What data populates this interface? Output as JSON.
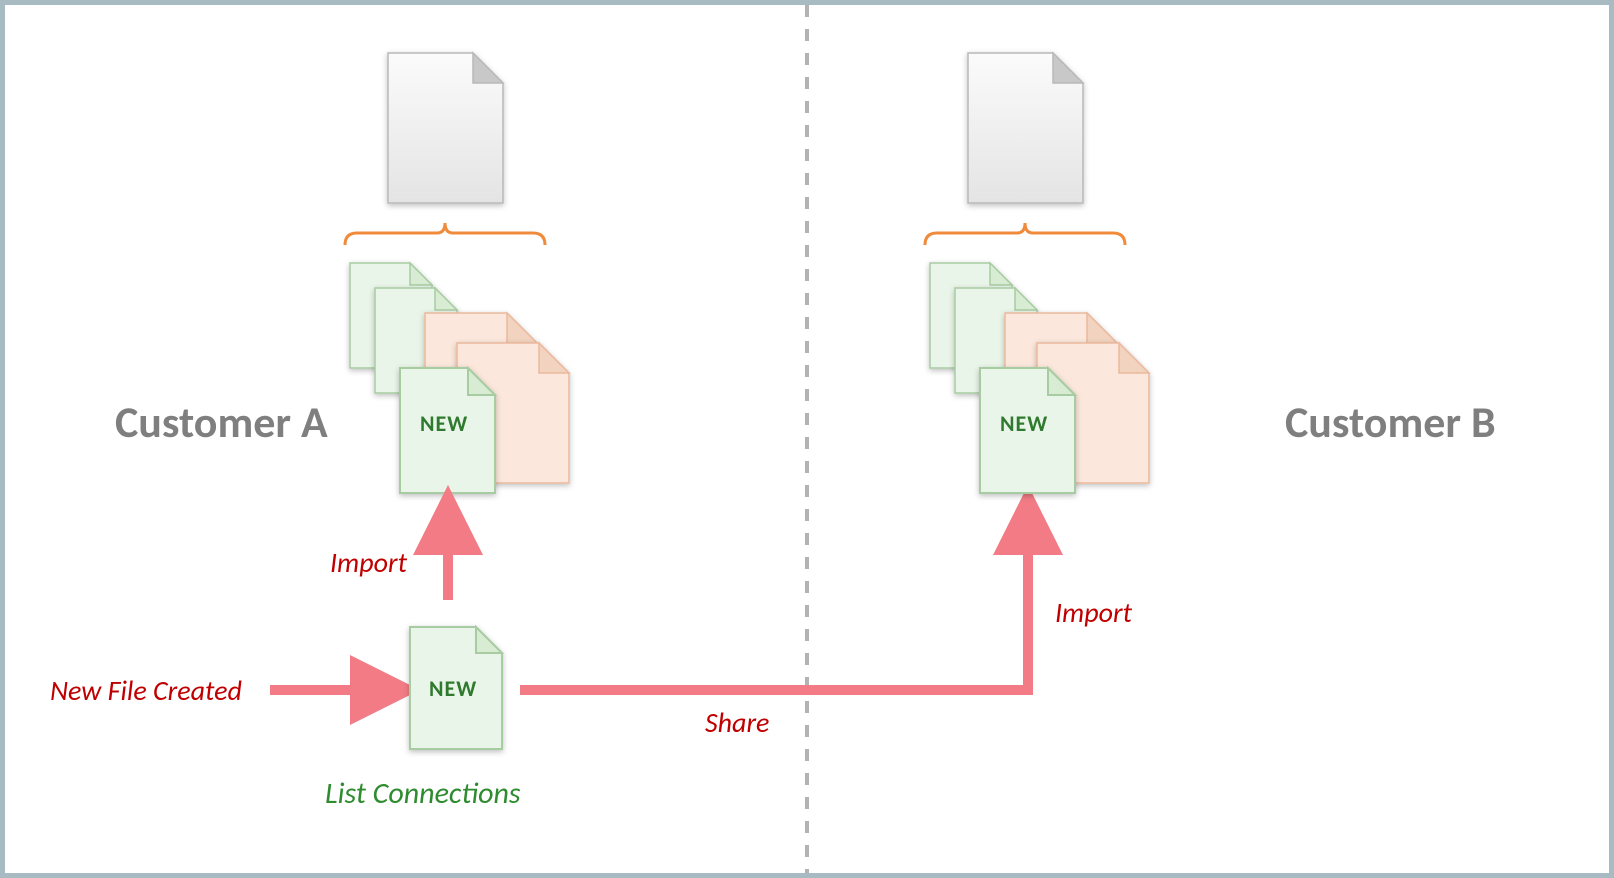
{
  "labels": {
    "customer_a": "Customer A",
    "customer_b": "Customer B",
    "new_file_created": "New File Created",
    "list_connections": "List Connections",
    "import": "Import",
    "share": "Share",
    "new": "NEW"
  },
  "colors": {
    "border": "#a8bbc3",
    "divider": "#b3b3b3",
    "red_arrow": "#f27b85",
    "red_text": "#c00000",
    "green_text": "#2e8b2e",
    "green_doc_fill": "#eaf5e9",
    "green_doc_stroke": "#a8cca2",
    "orange_doc_fill": "#fbe7db",
    "orange_doc_stroke": "#eab99c",
    "gray_doc_fill": "#f1f1f1",
    "gray_doc_stroke": "#9d9d9d",
    "brace": "#f08b3c"
  }
}
